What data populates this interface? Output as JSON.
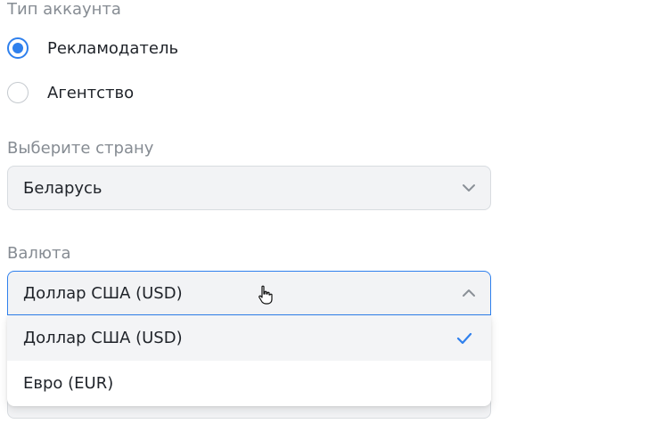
{
  "account_type": {
    "label": "Тип аккаунта",
    "options": [
      {
        "label": "Рекламодатель",
        "checked": true
      },
      {
        "label": "Агентство",
        "checked": false
      }
    ]
  },
  "country": {
    "label": "Выберите страну",
    "value": "Беларусь"
  },
  "currency": {
    "label": "Валюта",
    "value": "Доллар США (USD)",
    "options": [
      {
        "label": "Доллар США (USD)",
        "selected": true
      },
      {
        "label": "Евро (EUR)",
        "selected": false
      }
    ]
  },
  "colors": {
    "accent": "#2f80ed",
    "field_bg": "#f2f3f5",
    "muted_text": "#868c93"
  }
}
